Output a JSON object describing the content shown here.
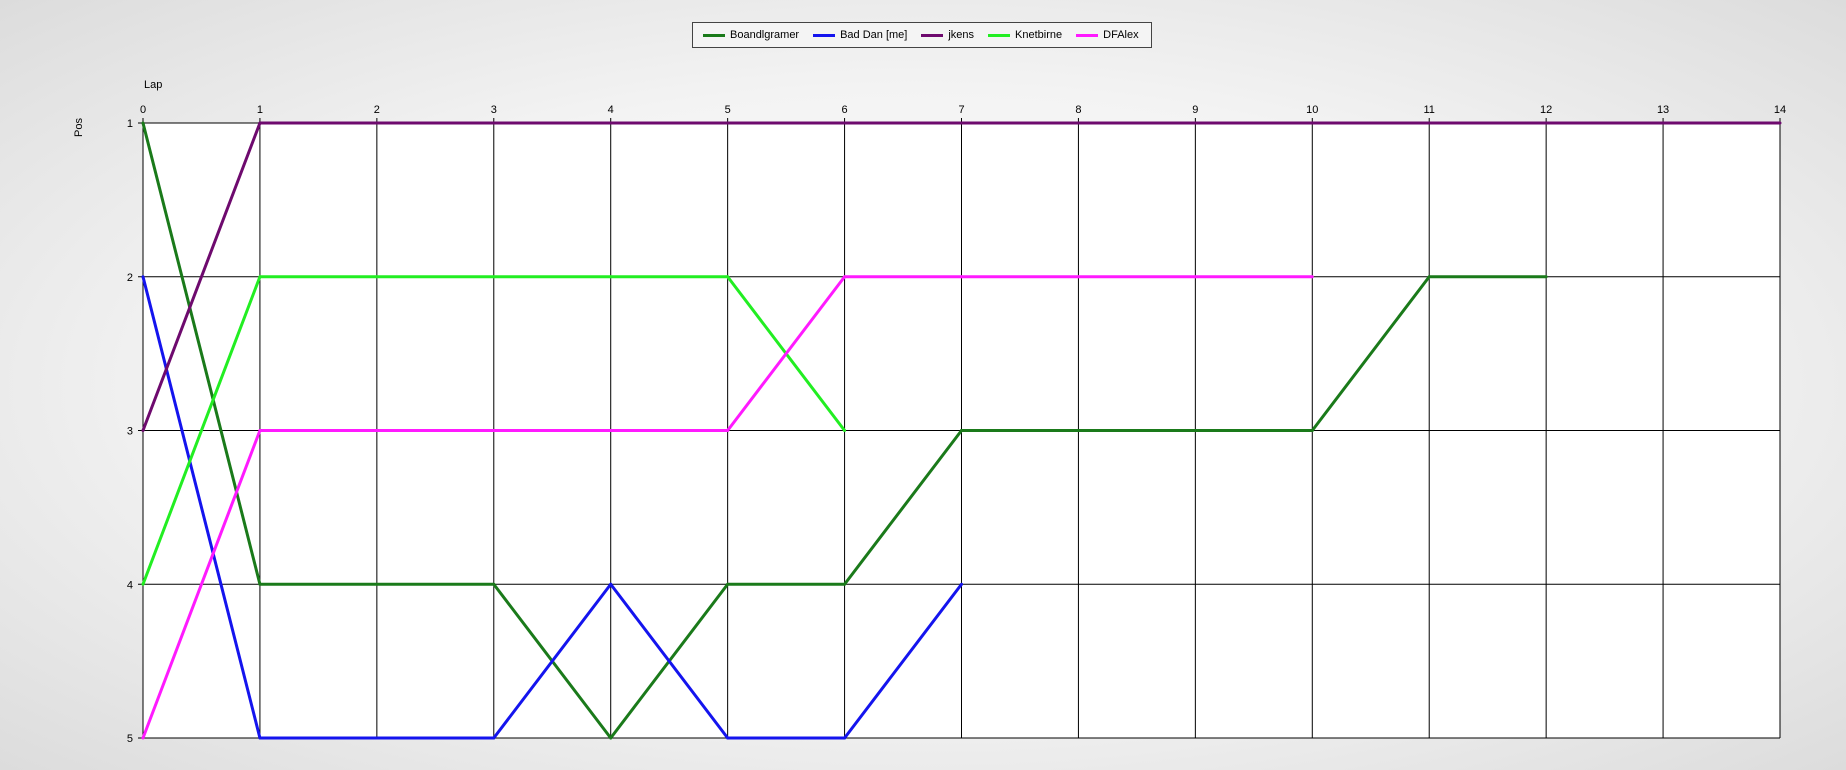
{
  "chart_data": {
    "type": "line",
    "xlabel": "Lap",
    "ylabel": "Pos",
    "xlim": [
      0,
      14
    ],
    "ylim": [
      1,
      5
    ],
    "y_inverted": true,
    "grid": true,
    "legend_position": "top-center",
    "x_ticks": [
      "0",
      "1",
      "2",
      "3",
      "4",
      "5",
      "6",
      "7",
      "8",
      "9",
      "10",
      "11",
      "12",
      "13",
      "14"
    ],
    "y_ticks": [
      "1",
      "2",
      "3",
      "4",
      "5"
    ],
    "series": [
      {
        "name": "Boandlgramer",
        "color": "#1a7a1a",
        "x": [
          0,
          1,
          2,
          3,
          4,
          5,
          6,
          7,
          8,
          9,
          10,
          11,
          12
        ],
        "y": [
          1,
          4,
          4,
          4,
          5,
          4,
          4,
          3,
          3,
          3,
          3,
          2,
          2
        ]
      },
      {
        "name": "Bad Dan [me]",
        "color": "#1414ee",
        "x": [
          0,
          1,
          2,
          3,
          4,
          5,
          6,
          7
        ],
        "y": [
          2,
          5,
          5,
          5,
          4,
          5,
          5,
          4
        ]
      },
      {
        "name": "jkens",
        "color": "#6e0a6e",
        "x": [
          0,
          1,
          2,
          3,
          4,
          5,
          6,
          7,
          8,
          9,
          10,
          11,
          12,
          13,
          14
        ],
        "y": [
          3,
          1,
          1,
          1,
          1,
          1,
          1,
          1,
          1,
          1,
          1,
          1,
          1,
          1,
          1
        ]
      },
      {
        "name": "Knetbirne",
        "color": "#22ee22",
        "x": [
          0,
          1,
          2,
          3,
          4,
          5,
          6
        ],
        "y": [
          4,
          2,
          2,
          2,
          2,
          2,
          3
        ]
      },
      {
        "name": "DFAlex",
        "color": "#ff1aff",
        "x": [
          0,
          1,
          2,
          3,
          4,
          5,
          6,
          7,
          8,
          9,
          10
        ],
        "y": [
          5,
          3,
          3,
          3,
          3,
          3,
          2,
          2,
          2,
          2,
          2
        ]
      }
    ]
  }
}
